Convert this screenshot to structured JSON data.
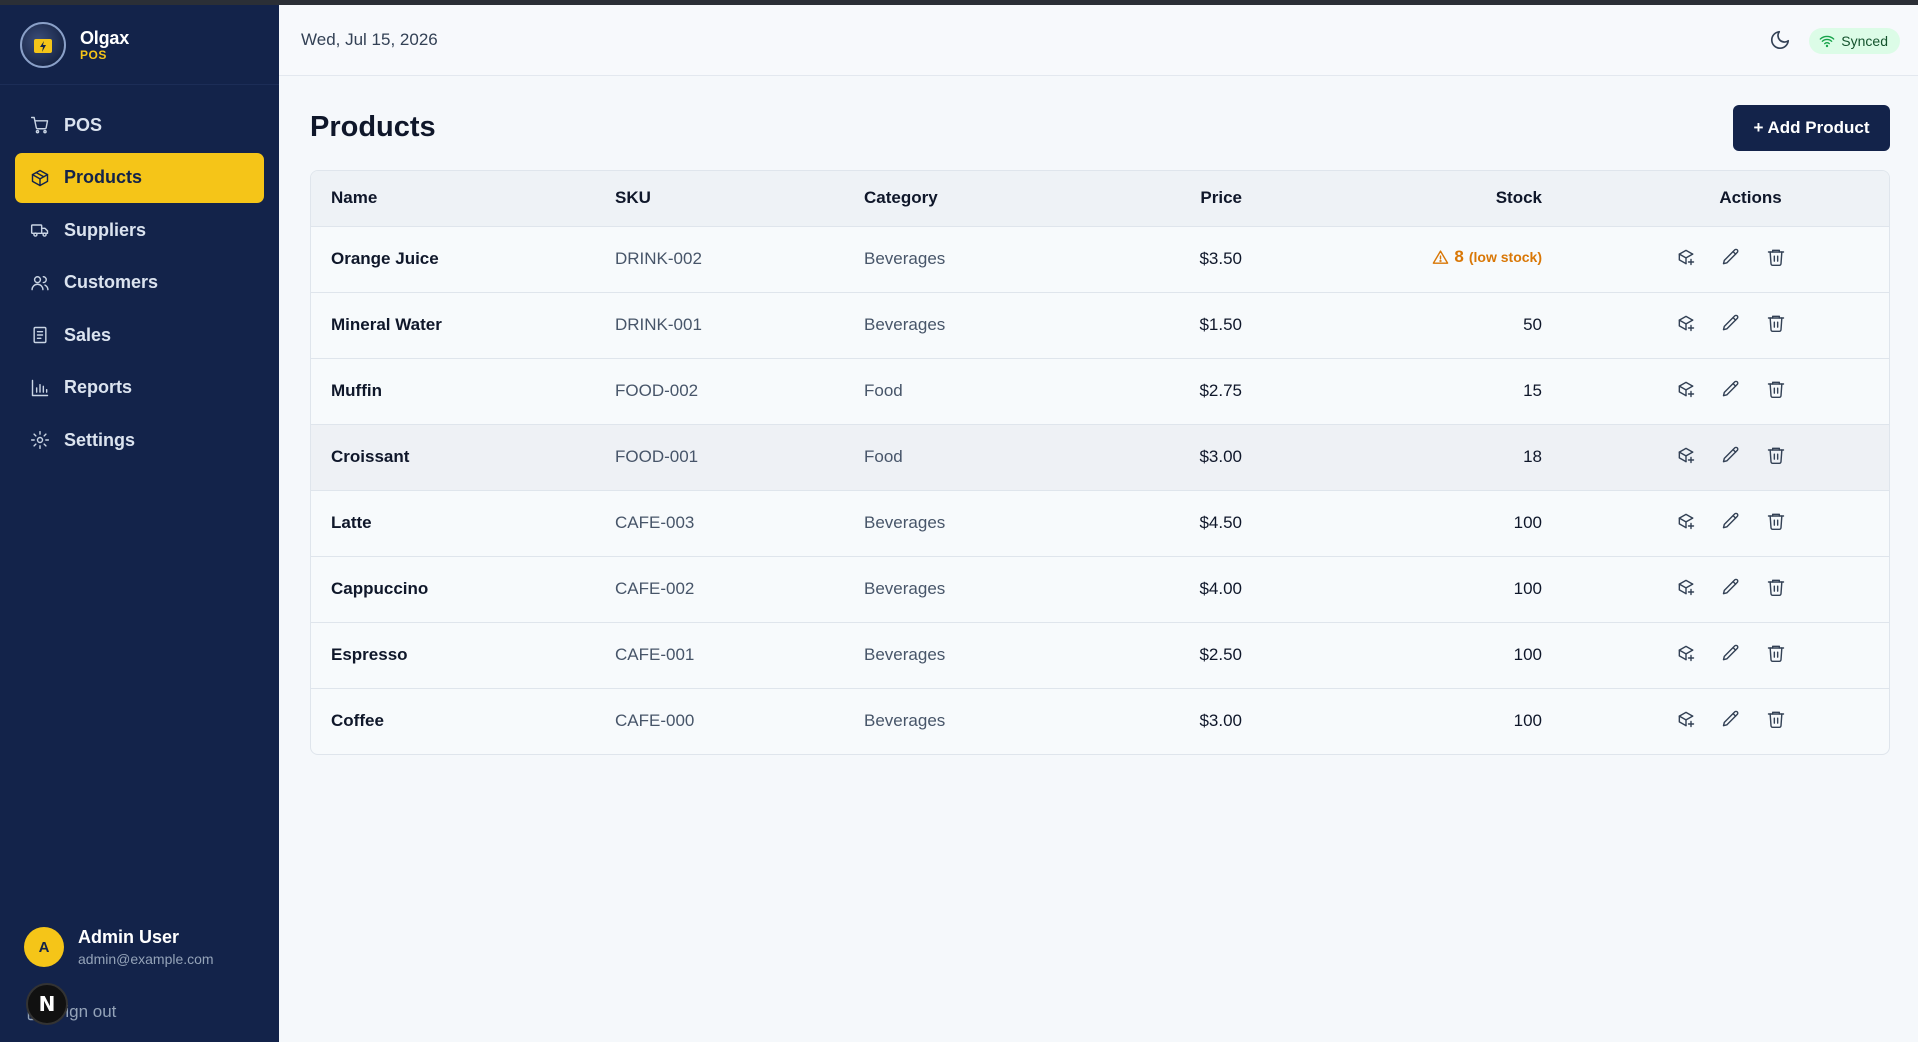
{
  "app": {
    "name": "Olgax",
    "subtitle": "POS"
  },
  "sidebar": {
    "items": [
      {
        "label": "POS",
        "icon": "cart-icon",
        "active": false
      },
      {
        "label": "Products",
        "icon": "package-icon",
        "active": true
      },
      {
        "label": "Suppliers",
        "icon": "truck-icon",
        "active": false
      },
      {
        "label": "Customers",
        "icon": "users-icon",
        "active": false
      },
      {
        "label": "Sales",
        "icon": "receipt-icon",
        "active": false
      },
      {
        "label": "Reports",
        "icon": "bar-chart-icon",
        "active": false
      },
      {
        "label": "Settings",
        "icon": "gear-icon",
        "active": false
      }
    ],
    "user": {
      "initial": "A",
      "name": "Admin User",
      "email": "admin@example.com"
    },
    "signout_label": "Sign out",
    "dev_badge": "N"
  },
  "topbar": {
    "date": "Wed, Jul 15, 2026",
    "sync_status": "Synced"
  },
  "page": {
    "title": "Products",
    "add_button": "+ Add Product"
  },
  "table": {
    "headers": {
      "name": "Name",
      "sku": "SKU",
      "category": "Category",
      "price": "Price",
      "stock": "Stock",
      "actions": "Actions"
    },
    "low_stock_label": "(low stock)",
    "rows": [
      {
        "name": "Orange Juice",
        "sku": "DRINK-002",
        "category": "Beverages",
        "price": "$3.50",
        "stock": "8",
        "low": true
      },
      {
        "name": "Mineral Water",
        "sku": "DRINK-001",
        "category": "Beverages",
        "price": "$1.50",
        "stock": "50",
        "low": false
      },
      {
        "name": "Muffin",
        "sku": "FOOD-002",
        "category": "Food",
        "price": "$2.75",
        "stock": "15",
        "low": false
      },
      {
        "name": "Croissant",
        "sku": "FOOD-001",
        "category": "Food",
        "price": "$3.00",
        "stock": "18",
        "low": false
      },
      {
        "name": "Latte",
        "sku": "CAFE-003",
        "category": "Beverages",
        "price": "$4.50",
        "stock": "100",
        "low": false
      },
      {
        "name": "Cappuccino",
        "sku": "CAFE-002",
        "category": "Beverages",
        "price": "$4.00",
        "stock": "100",
        "low": false
      },
      {
        "name": "Espresso",
        "sku": "CAFE-001",
        "category": "Beverages",
        "price": "$2.50",
        "stock": "100",
        "low": false
      },
      {
        "name": "Coffee",
        "sku": "CAFE-000",
        "category": "Beverages",
        "price": "$3.00",
        "stock": "100",
        "low": false
      }
    ]
  },
  "colors": {
    "sidebar_bg": "#13234a",
    "accent": "#f5c518",
    "warning": "#d97706",
    "sync_bg": "#dcfce7"
  }
}
